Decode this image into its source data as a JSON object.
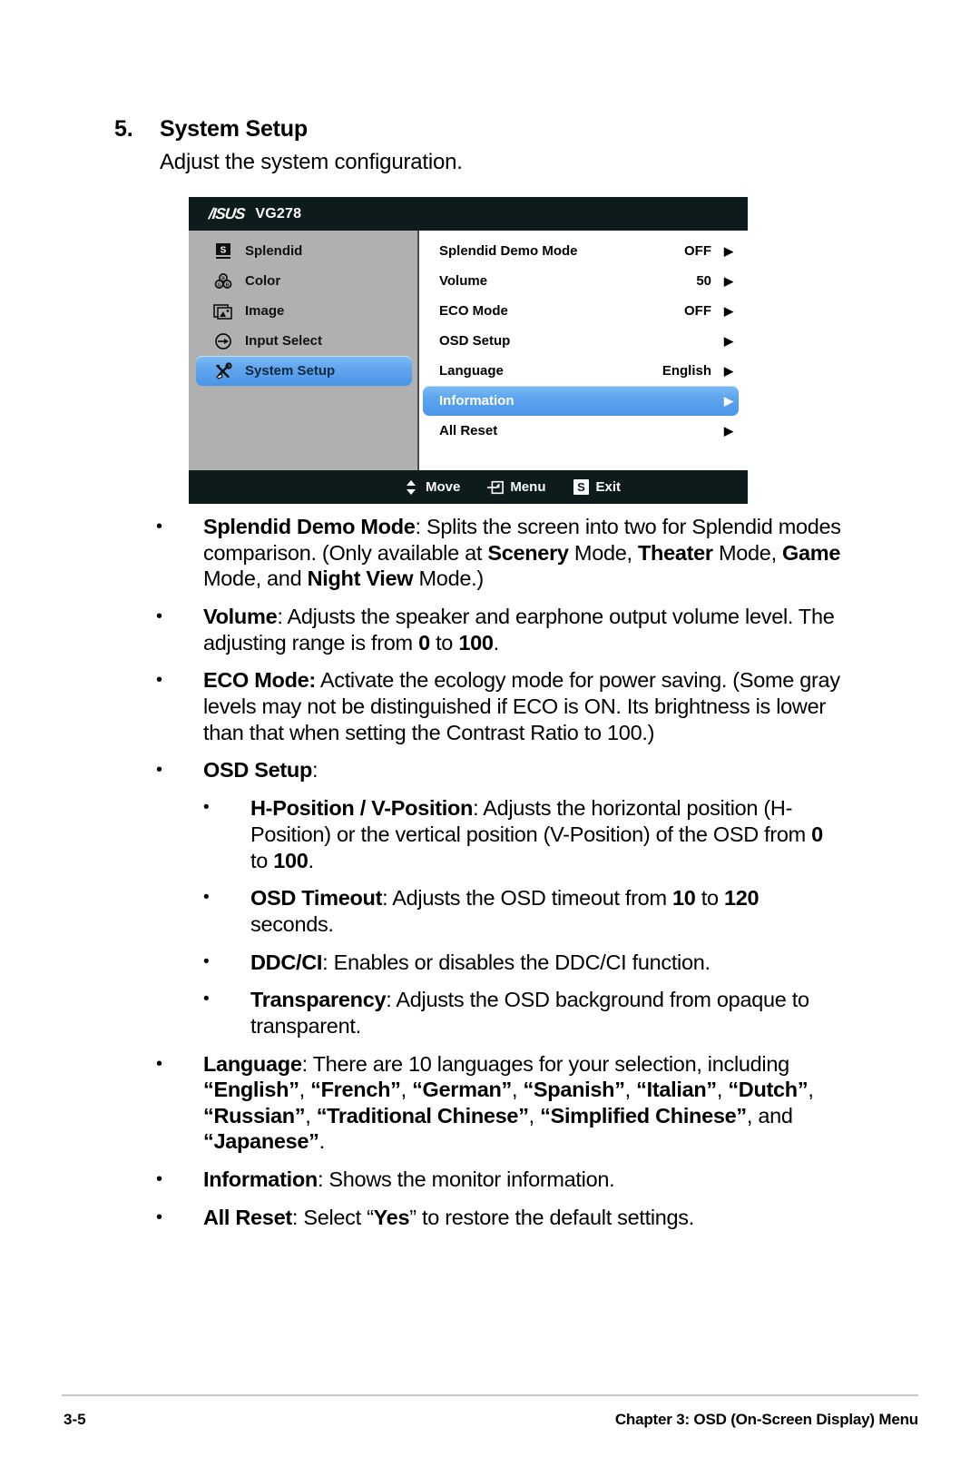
{
  "heading": {
    "number": "5.",
    "title": "System Setup",
    "intro": "Adjust the system configuration."
  },
  "osd": {
    "brand": "/ISUS",
    "model": "VG278",
    "sidebar": [
      {
        "icon": "splendid-icon",
        "label": "Splendid",
        "selected": false
      },
      {
        "icon": "color-icon",
        "label": "Color",
        "selected": false
      },
      {
        "icon": "image-icon",
        "label": "Image",
        "selected": false
      },
      {
        "icon": "input-select-icon",
        "label": "Input Select",
        "selected": false
      },
      {
        "icon": "system-setup-icon",
        "label": "System Setup",
        "selected": true
      }
    ],
    "menu": [
      {
        "label": "Splendid Demo Mode",
        "value": "OFF",
        "arrow": "▶",
        "selected": false
      },
      {
        "label": "Volume",
        "value": "50",
        "arrow": "▶",
        "selected": false
      },
      {
        "label": "ECO Mode",
        "value": "OFF",
        "arrow": "▶",
        "selected": false
      },
      {
        "label": "OSD Setup",
        "value": "",
        "arrow": "▶",
        "selected": false
      },
      {
        "label": "Language",
        "value": "English",
        "arrow": "▶",
        "selected": false
      },
      {
        "label": "Information",
        "value": "",
        "arrow": "▶",
        "selected": true
      },
      {
        "label": "All Reset",
        "value": "",
        "arrow": "▶",
        "selected": false
      }
    ],
    "footer": [
      {
        "icon": "up-down-arrows-icon",
        "label": "Move"
      },
      {
        "icon": "menu-enter-icon",
        "label": "Menu"
      },
      {
        "icon": "s-badge-icon",
        "label": "Exit"
      }
    ],
    "colors": {
      "titlebar": "#0e1b1c",
      "sidebar": "#b0b0b0",
      "highlight": "#4a95e8",
      "highlight_light": "#7dbcf5"
    }
  },
  "bullets": [
    {
      "id": "splendid-demo-mode",
      "bullet": "•",
      "html": "<b>Splendid Demo Mode</b>: Splits the screen into two for Splendid modes comparison. (Only available at <b>Scenery</b> Mode, <b>Theater</b> Mode, <b>Game</b> Mode, and <b>Night View</b> Mode.)"
    },
    {
      "id": "volume",
      "bullet": "•",
      "html": "<b>Volume</b>: Adjusts the  speaker and earphone output volume level. The adjusting range is from <b>0</b> to <b>100</b>."
    },
    {
      "id": "eco-mode",
      "bullet": "•",
      "html": "<b>ECO Mode:</b> Activate the ecology mode for power saving. (Some gray levels may not be distinguished if ECO is ON. Its brightness is lower than that when setting the Contrast Ratio to 100.)"
    },
    {
      "id": "osd-setup",
      "bullet": "•",
      "html": "<b>OSD Setup</b>:"
    }
  ],
  "sub_bullets": [
    {
      "id": "h-position-v-position",
      "bullet": "•",
      "html": "<b>H-Position / V-Position</b>: Adjusts the horizontal position (H-Position) or the vertical position (V-Position) of the OSD from <b>0</b> to <b>100</b>."
    },
    {
      "id": "osd-timeout",
      "bullet": "•",
      "html": "<b>OSD Timeout</b>: Adjusts the OSD timeout from <b>10</b> to <b>120</b> seconds."
    },
    {
      "id": "ddc-ci",
      "bullet": "•",
      "html": "<b>DDC/CI</b>: Enables or disables the DDC/CI function."
    },
    {
      "id": "transparency",
      "bullet": "•",
      "html": "<b>Transparency</b>: Adjusts the OSD background from opaque to transparent."
    }
  ],
  "bullets_tail": [
    {
      "id": "language",
      "bullet": "•",
      "html": "<b>Language</b>: There are 10 languages for your selection, including <b>“English”</b>, <b>“French”</b>, <b>“German”</b>, <b>“Spanish”</b>, <b>“Italian”</b>, <b>“Dutch”</b>, <b>“Russian”</b>, <b>“Traditional Chinese”</b>, <b>“Simplified Chinese”</b>, and <b>“Japanese”</b>."
    },
    {
      "id": "information",
      "bullet": "•",
      "html": "<b>Information</b>: Shows the monitor information."
    },
    {
      "id": "all-reset",
      "bullet": "•",
      "html": "<b>All Reset</b>: Select “<b>Yes</b>” to restore the default settings."
    }
  ],
  "footer": {
    "page_number": "3-5",
    "chapter": "Chapter 3: OSD (On-Screen Display) Menu"
  }
}
